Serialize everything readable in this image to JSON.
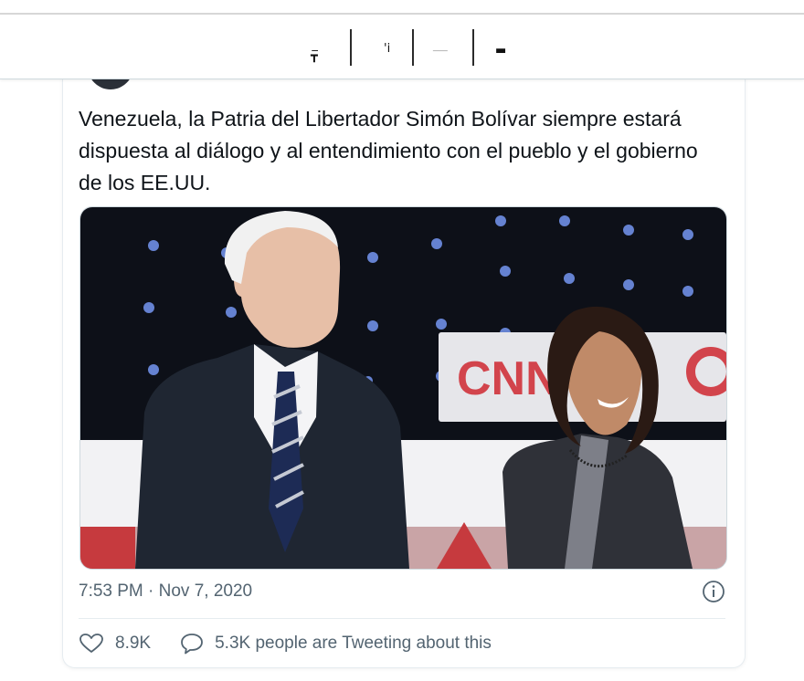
{
  "topbar": {},
  "tweet": {
    "text": "Venezuela, la Patria del Libertador Simón Bolívar siempre estará dispuesta al diálogo y al entendimiento con el pueblo y el gobierno de los EE.UU.",
    "photo": {
      "sign_text": "CNN"
    },
    "timestamp": "7:53 PM · Nov 7, 2020",
    "likes": "8.9K",
    "tweeting": "5.3K people are Tweeting about this"
  },
  "icons": {
    "like": "heart-icon",
    "reply": "speech-bubble-icon",
    "info": "info-icon"
  },
  "colors": {
    "text": "#0f1419",
    "secondary": "#536471",
    "border": "#e6ecf0"
  }
}
